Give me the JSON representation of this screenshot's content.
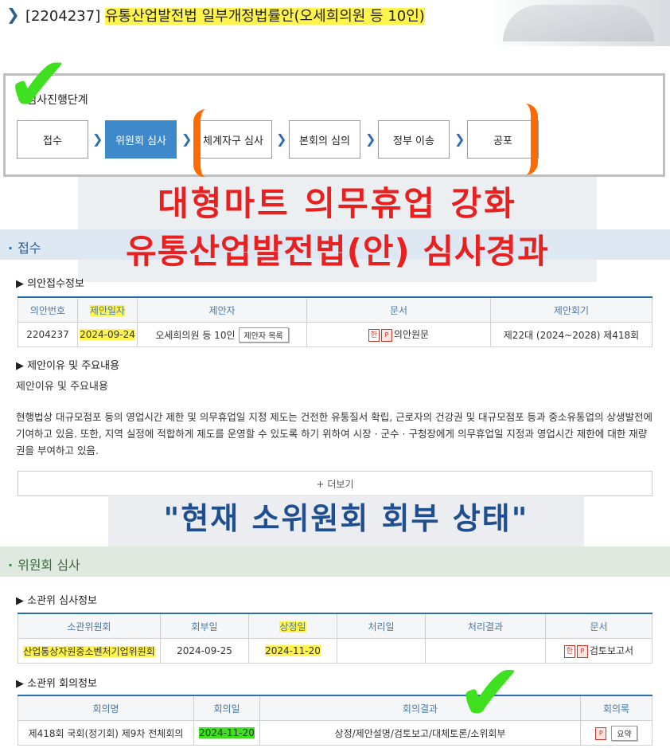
{
  "header": {
    "bill_no": "[2204237]",
    "bill_name": "유통산업발전법 일부개정법률안",
    "proposer": "(오세희의원 등 10인)"
  },
  "stages": {
    "label": "심사진행단계",
    "items": [
      "접수",
      "위원회 심사",
      "체계자구 심사",
      "본회의 심의",
      "정부 이송",
      "공포"
    ],
    "active_index": 1
  },
  "overlay": {
    "line1": "대형마트 의무휴업 강화",
    "line2": "유통산업발전법(안) 심사경과",
    "line3": "\"현재 소위원회 회부 상태\""
  },
  "receipt": {
    "section_title": "접수",
    "sub_title": "의안접수정보",
    "headers": [
      "의안번호",
      "제안일자",
      "제안자",
      "문서",
      "제안회기"
    ],
    "row": {
      "bill_no": "2204237",
      "date": "2024-09-24",
      "proposer": "오세희의원 등 10인",
      "proposer_btn": "제안자 목록",
      "doc": "의안원문",
      "session": "제22대 (2024~2028) 제418회"
    }
  },
  "reason": {
    "sub_title": "제안이유 및 주요내용",
    "label": "제안이유 및 주요내용",
    "text": "현행법상 대규모점포 등의 영업시간 제한 및 의무휴업일 지정 제도는 건전한 유통질서 확립, 근로자의 건강권 및 대규모점포 등과 중소유통업의 상생발전에 기여하고 있음. 또한, 지역 실정에 적합하게 제도를 운영할 수 있도록 하기 위하여 시장 · 군수 · 구청장에게 의무휴업일 지정과 영업시간 제한에 대한 재량권을 부여하고 있음.",
    "more": "+ 더보기"
  },
  "committee": {
    "section_title": "위원회 심사",
    "sub_title": "소관위 심사정보",
    "headers": [
      "소관위원회",
      "회부일",
      "상정일",
      "처리일",
      "처리결과",
      "문서"
    ],
    "row": {
      "committee": "산업통상자원중소벤처기업위원회",
      "refer_date": "2024-09-25",
      "present_date": "2024-11-20",
      "process_date": "",
      "result": "",
      "doc": "검토보고서"
    },
    "meeting_sub_title": "소관위 회의정보",
    "meeting_headers": [
      "회의명",
      "회의일",
      "회의결과",
      "회의록"
    ],
    "meeting_row": {
      "name": "제418회 국회(정기회) 제9차 전체회의",
      "date": "2024-11-20",
      "result": "상정/제안설명/검토보고/대체토론/소위회부",
      "minutes_btn": "요약"
    }
  },
  "colors": {
    "accent": "#2b6fb3",
    "highlight": "#fff34d",
    "overlay_red": "#e8201f",
    "check_green": "#3ee01f",
    "bracket_orange": "#ff6a00"
  }
}
